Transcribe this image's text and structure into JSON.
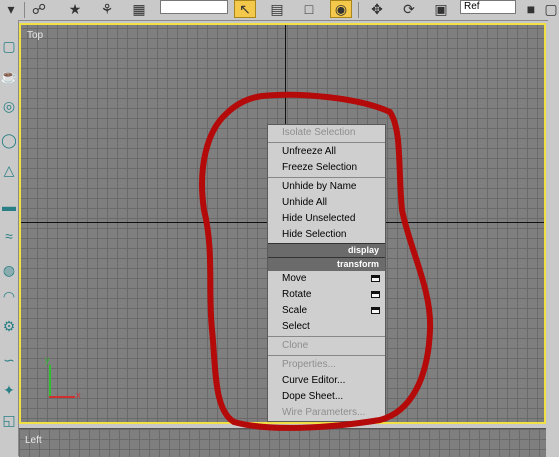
{
  "viewport": {
    "label": "Top"
  },
  "bottom_viewport": {
    "label": "Left"
  },
  "toolbar": {
    "icons": [
      "select-filter-icon",
      "link-icon",
      "unlink-icon",
      "select-object-icon",
      "select-region-icon",
      "select-window-icon",
      "move-icon",
      "rotate-icon",
      "scale-icon"
    ],
    "field_value": "",
    "ref_coord_value": "Ref"
  },
  "quad_menu": {
    "group1": [
      {
        "label": "Isolate Selection",
        "disabled": true
      },
      {
        "label": "Unfreeze All",
        "disabled": false
      },
      {
        "label": "Freeze Selection",
        "disabled": false
      }
    ],
    "group2": [
      {
        "label": "Unhide by Name",
        "disabled": false
      },
      {
        "label": "Unhide All",
        "disabled": false
      },
      {
        "label": "Hide Unselected",
        "disabled": false
      },
      {
        "label": "Hide Selection",
        "disabled": false
      }
    ],
    "display_header": "display",
    "transform_header": "transform",
    "group3": [
      {
        "label": "Move",
        "option_box": true
      },
      {
        "label": "Rotate",
        "option_box": true
      },
      {
        "label": "Scale",
        "option_box": true
      },
      {
        "label": "Select",
        "option_box": false
      }
    ],
    "group4": [
      {
        "label": "Clone",
        "disabled": true
      }
    ],
    "group5": [
      {
        "label": "Properties...",
        "disabled": true
      },
      {
        "label": "Curve Editor...",
        "disabled": false
      },
      {
        "label": "Dope Sheet...",
        "disabled": false
      },
      {
        "label": "Wire Parameters...",
        "disabled": true
      }
    ]
  },
  "gizmo": {
    "y_label": "y",
    "x_label": "x"
  },
  "colors": {
    "viewport_border": "#f0e045",
    "marker": "#b50a0a",
    "grid": "#7f7f7f"
  }
}
